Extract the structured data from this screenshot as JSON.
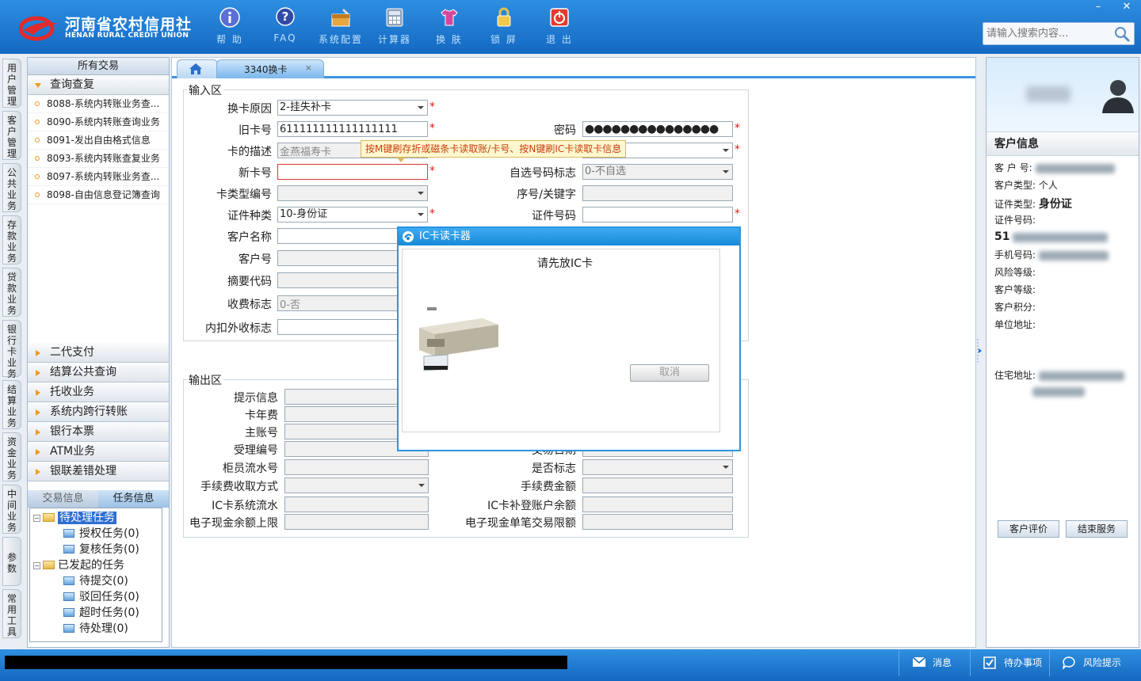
{
  "app": {
    "logo_cn": "河南省农村信用社",
    "logo_en": "HENAN RURAL CREDIT UNION",
    "window_min": "–",
    "window_close": "✕",
    "search_placeholder": "请输入搜索内容..."
  },
  "toolbar": [
    {
      "key": "help",
      "label": "帮 助"
    },
    {
      "key": "faq",
      "label": "FAQ"
    },
    {
      "key": "config",
      "label": "系统配置"
    },
    {
      "key": "calc",
      "label": "计算器"
    },
    {
      "key": "skin",
      "label": "换 肤"
    },
    {
      "key": "lock",
      "label": "锁 屏"
    },
    {
      "key": "exit",
      "label": "退 出"
    }
  ],
  "vertical_tabs": [
    "用户管理",
    "客户管理",
    "公共业务",
    "存款业务",
    "贷款业务",
    "银行卡业务",
    "结算业务",
    "资金业务",
    "中间业务",
    "参数",
    "常用工具"
  ],
  "nav": {
    "header": "所有交易",
    "open_group": "查询查复",
    "items": [
      "8088-系统内转账业务查...",
      "8090-系统内转账查询业务",
      "8091-发出自由格式信息",
      "8093-系统内转账查复业务",
      "8097-系统内转账业务查...",
      "8098-自由信息登记簿查询"
    ],
    "groups": [
      "二代支付",
      "结算公共查询",
      "托收业务",
      "系统内跨行转账",
      "银行本票",
      "ATM业务",
      "银联差错处理"
    ],
    "info_tabs": [
      "交易信息",
      "任务信息"
    ],
    "tree": {
      "pending": "待处理任务",
      "auth": "授权任务(0)",
      "review": "复核任务(0)",
      "initiated": "已发起的任务",
      "to_submit": "待提交(0)",
      "rejected": "驳回任务(0)",
      "timeout": "超时任务(0)",
      "to_handle": "待处理(0)"
    }
  },
  "tabs": {
    "active": "3340换卡",
    "close": "×"
  },
  "input_area": {
    "title": "输入区",
    "reason_label": "换卡原因",
    "reason_value": "2-挂失补卡",
    "old_card_label": "旧卡号",
    "old_card_value": "611111111111111111",
    "password_label": "密码",
    "password_value": "●●●●●●●●●●●●●●●",
    "desc_label": "卡的描述",
    "desc_value": "金燕福寿卡",
    "new_card_label": "新卡号",
    "new_card_value": "",
    "selfnum_label": "自选号码标志",
    "selfnum_value": "0-不自选",
    "cardtype_label": "卡类型编号",
    "cardtype_value": "",
    "seq_label": "序号/关键字",
    "seq_value": "",
    "idtype_label": "证件种类",
    "idtype_value": "10-身份证",
    "idnum_label": "证件号码",
    "idnum_value": "",
    "custname_label": "客户名称",
    "custname_value": "",
    "custno_label": "客户号",
    "custno_value": "",
    "summary_label": "摘要代码",
    "summary_value": "",
    "fee_label": "收费标志",
    "fee_value": "0-否",
    "feein_label": "内扣外收标志",
    "feein_value": ""
  },
  "tooltip": "按M键刷存折或磁条卡读取账/卡号、按N键刷IC卡读取卡信息",
  "output_area": {
    "title": "输出区",
    "hint_label": "提示信息",
    "annual_label": "卡年费",
    "main_acct_label": "主账号",
    "accept_label": "受理编号",
    "trade_date_label": "交易日期",
    "teller_label": "柜员流水号",
    "whether_label": "是否标志",
    "fee_mode_label": "手续费收取方式",
    "fee_amount_label": "手续费金额",
    "ic_serial_label": "IC卡系统流水",
    "ic_balance_label": "IC卡补登账户余额",
    "ecash_limit_label": "电子现金余额上限",
    "ecash_single_label": "电子现金单笔交易限额"
  },
  "modal": {
    "title": "IC卡读卡器",
    "message": "请先放IC卡",
    "cancel": "取消"
  },
  "customer": {
    "title": "客户信息",
    "no_label": "客 户 号:",
    "type_label": "客户类型:",
    "type_value": "个人",
    "idtype_label": "证件类型:",
    "idtype_value": "身份证",
    "idnum_label": "证件号码:",
    "idnum_prefix": "51",
    "phone_label": "手机号码:",
    "risk_label": "风险等级:",
    "level_label": "客户等级:",
    "points_label": "客户积分:",
    "work_label": "单位地址:",
    "home_label": "住宅地址:",
    "eval_button": "客户评价",
    "end_button": "结束服务"
  },
  "statusbar": {
    "message": "消息",
    "todo": "待办事项",
    "risk": "风险提示"
  }
}
